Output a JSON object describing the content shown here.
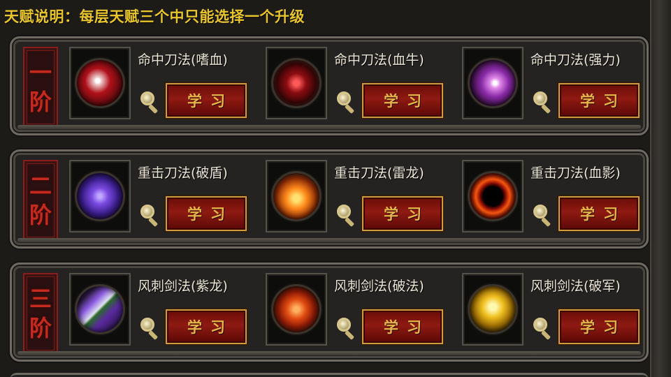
{
  "header": {
    "text": "天赋说明：每层天赋三个中只能选择一个升级"
  },
  "tiers": [
    {
      "badge": [
        "一",
        "阶"
      ],
      "talents": [
        {
          "name": "命中刀法(嗜血)",
          "button": "学习",
          "icon": "blood-claw-icon"
        },
        {
          "name": "命中刀法(血牛)",
          "button": "学习",
          "icon": "blood-rune-icon"
        },
        {
          "name": "命中刀法(强力)",
          "button": "学习",
          "icon": "purple-slash-icon"
        }
      ]
    },
    {
      "badge": [
        "二",
        "阶"
      ],
      "talents": [
        {
          "name": "重击刀法(破盾)",
          "button": "学习",
          "icon": "lightning-shield-icon"
        },
        {
          "name": "重击刀法(雷龙)",
          "button": "学习",
          "icon": "fire-dragon-icon"
        },
        {
          "name": "重击刀法(血影)",
          "button": "学习",
          "icon": "blood-ring-icon"
        }
      ]
    },
    {
      "badge": [
        "三",
        "阶"
      ],
      "talents": [
        {
          "name": "风刺剑法(紫龙)",
          "button": "学习",
          "icon": "purple-blade-icon"
        },
        {
          "name": "风刺剑法(破法)",
          "button": "学习",
          "icon": "flame-sword-icon"
        },
        {
          "name": "风刺剑法(破军)",
          "button": "学习",
          "icon": "golden-sword-icon"
        }
      ]
    }
  ],
  "colors": {
    "header_text": "#e9c52c",
    "badge_red": "#c42a1e",
    "button_bg": "#8e1a12",
    "button_text": "#e6b64a",
    "panel_border": "#6e6a62"
  }
}
